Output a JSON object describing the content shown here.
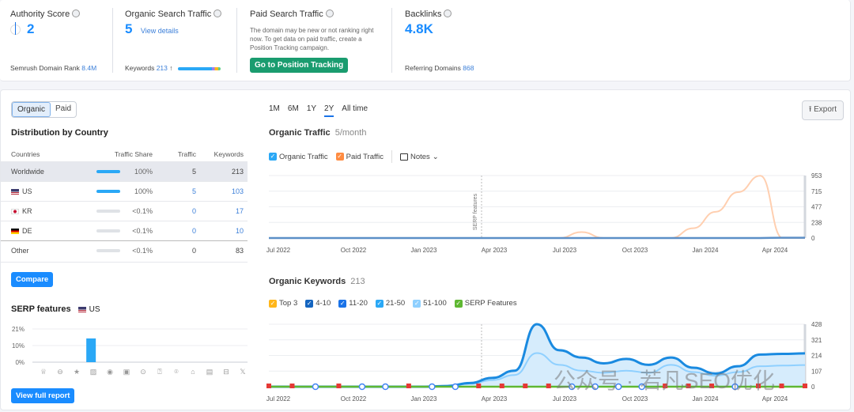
{
  "metrics": {
    "authority": {
      "title": "Authority Score",
      "value": "2",
      "sub_label": "Semrush Domain Rank",
      "sub_value": "8.4M"
    },
    "organic": {
      "title": "Organic Search Traffic",
      "value": "5",
      "link": "View details",
      "sub_label": "Keywords",
      "sub_value": "213",
      "trend": "↑"
    },
    "paid": {
      "title": "Paid Search Traffic",
      "desc": "The domain may be new or not ranking right now. To get data on paid traffic, create a Position Tracking campaign.",
      "button": "Go to Position Tracking"
    },
    "backlinks": {
      "title": "Backlinks",
      "value": "4.8K",
      "sub_label": "Referring Domains",
      "sub_value": "868"
    }
  },
  "toggle": {
    "organic": "Organic",
    "paid": "Paid"
  },
  "distribution": {
    "title": "Distribution by Country",
    "headers": [
      "Countries",
      "Traffic Share",
      "Traffic",
      "Keywords"
    ],
    "rows": [
      {
        "country": "Worldwide",
        "share": "100%",
        "traffic": "5",
        "keywords": "213"
      },
      {
        "country": "US",
        "share": "100%",
        "traffic": "5",
        "keywords": "103"
      },
      {
        "country": "KR",
        "share": "<0.1%",
        "traffic": "0",
        "keywords": "17"
      },
      {
        "country": "DE",
        "share": "<0.1%",
        "traffic": "0",
        "keywords": "10"
      },
      {
        "country": "Other",
        "share": "<0.1%",
        "traffic": "0",
        "keywords": "83"
      }
    ],
    "compare_button": "Compare"
  },
  "serp": {
    "title": "SERP features",
    "country": "US",
    "yticks": [
      "21%",
      "10%",
      "0%"
    ],
    "values_pct": [
      0,
      0,
      0,
      15,
      0,
      0,
      0,
      0,
      0,
      0,
      0,
      0,
      0
    ],
    "icons": [
      "crown-icon",
      "link-icon",
      "star-icon",
      "image-icon",
      "video-icon",
      "video-box-icon",
      "play-icon",
      "question-icon",
      "location-icon",
      "academic-icon",
      "document-icon",
      "briefcase-icon",
      "x-icon"
    ],
    "button": "View full report"
  },
  "range": {
    "options": [
      "1M",
      "6M",
      "1Y",
      "2Y",
      "All time"
    ],
    "selected": "2Y"
  },
  "export_label": "Export",
  "chart_data": [
    {
      "type": "line",
      "title": "Organic Traffic",
      "subtitle": "5/month",
      "legend": [
        "Organic Traffic",
        "Paid Traffic"
      ],
      "notes_label": "Notes",
      "annotation": "SERP features",
      "x": [
        "Jul 2022",
        "Oct 2022",
        "Jan 2023",
        "Apr 2023",
        "Jul 2023",
        "Oct 2023",
        "Jan 2024",
        "Apr 2024"
      ],
      "yticks": [
        953,
        715,
        477,
        238,
        0
      ],
      "ylim": [
        0,
        953
      ],
      "series": [
        {
          "name": "Organic Traffic",
          "color": "#2aa8f6",
          "values": [
            0,
            0,
            0,
            0,
            0,
            0,
            0,
            0,
            0,
            0,
            0,
            0,
            0,
            0,
            0,
            0,
            0,
            0,
            0,
            0,
            0,
            0,
            0,
            5,
            5
          ]
        },
        {
          "name": "Paid Traffic",
          "color": "#ffcfb0",
          "values": [
            0,
            0,
            0,
            0,
            0,
            0,
            0,
            0,
            0,
            0,
            0,
            0,
            0,
            0,
            90,
            0,
            0,
            0,
            0,
            150,
            400,
            700,
            950,
            0,
            0
          ]
        }
      ]
    },
    {
      "type": "area",
      "title": "Organic Keywords",
      "subtitle": "213",
      "legend": [
        "Top 3",
        "4-10",
        "11-20",
        "21-50",
        "51-100",
        "SERP Features"
      ],
      "legend_colors": [
        "#ffb61a",
        "#1565c0",
        "#1a73e8",
        "#2aa8f6",
        "#8fd0ff",
        "#5fb832"
      ],
      "x": [
        "Jul 2022",
        "Oct 2022",
        "Jan 2023",
        "Apr 2023",
        "Jul 2023",
        "Oct 2023",
        "Jan 2024",
        "Apr 2024"
      ],
      "yticks": [
        428,
        321,
        214,
        107,
        0
      ],
      "ylim": [
        0,
        428
      ],
      "series": [
        {
          "name": "Total",
          "values": [
            0,
            0,
            0,
            0,
            0,
            0,
            0,
            0,
            5,
            25,
            60,
            110,
            428,
            250,
            200,
            160,
            190,
            150,
            200,
            130,
            90,
            140,
            220,
            225,
            228
          ]
        },
        {
          "name": "51-100",
          "values": [
            0,
            0,
            0,
            0,
            0,
            0,
            0,
            0,
            5,
            20,
            45,
            80,
            230,
            150,
            110,
            95,
            110,
            95,
            150,
            100,
            75,
            100,
            140,
            145,
            148
          ]
        }
      ]
    }
  ],
  "watermark": "公众号 · 若凡SEO优化"
}
